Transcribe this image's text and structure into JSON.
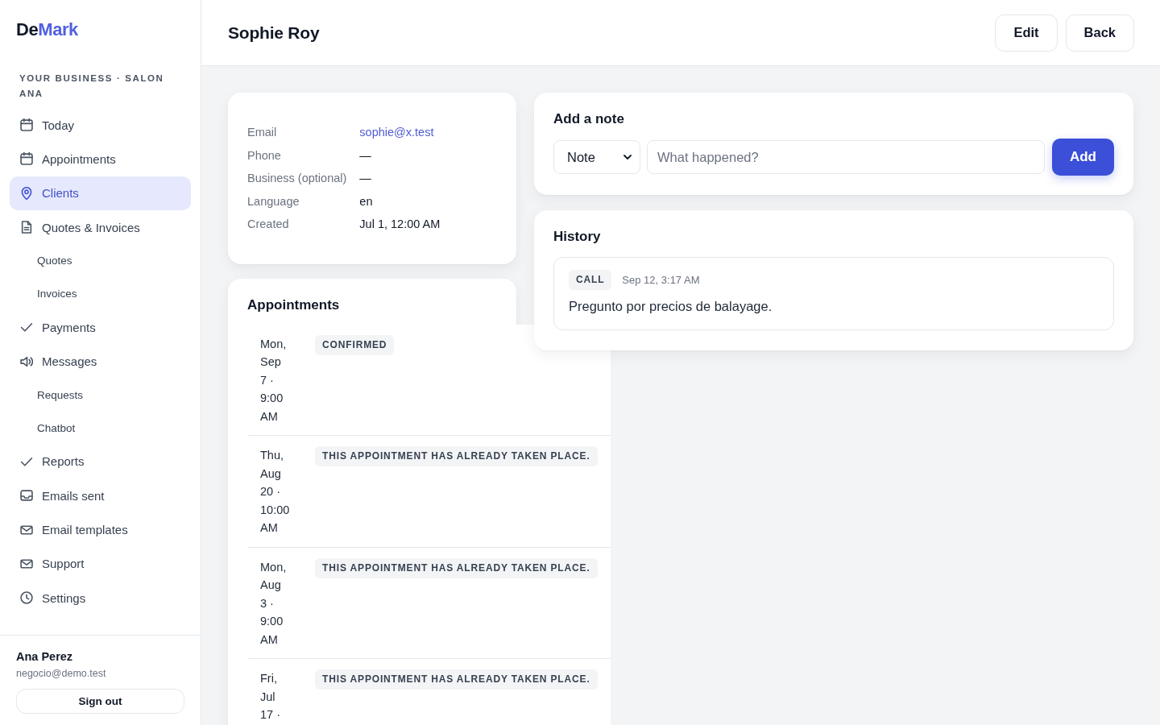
{
  "sidebar": {
    "logo": [
      {
        "text": "De",
        "accent": false
      },
      {
        "text": "Mark",
        "accent": true
      }
    ],
    "business": "YOUR BUSINESS · SALON ANA",
    "nav": [
      {
        "label": "Today",
        "selected": false
      },
      {
        "label": "Appointments",
        "selected": false
      },
      {
        "label": "Clients",
        "selected": true
      },
      {
        "label": "Quotes & Invoices",
        "selected": false,
        "children": [
          {
            "label": "Quotes",
            "selected": false
          },
          {
            "label": "Invoices",
            "selected": false
          }
        ]
      },
      {
        "label": "Payments",
        "selected": false
      },
      {
        "label": "Messages",
        "selected": false,
        "children": [
          {
            "label": "Requests",
            "selected": false
          },
          {
            "label": "Chatbot",
            "selected": false
          }
        ]
      },
      {
        "label": "Reports",
        "selected": false
      },
      {
        "label": "Emails sent",
        "selected": false
      },
      {
        "label": "Email templates",
        "selected": false
      },
      {
        "label": "Support",
        "selected": false
      },
      {
        "label": "Settings",
        "selected": false
      }
    ],
    "user": {
      "name": "Ana Perez",
      "email": "negocio@demo.test"
    },
    "sign_out": "Sign out"
  },
  "header": {
    "title": "Sophie Roy",
    "buttons": [
      "Edit",
      "Back"
    ]
  },
  "client": {
    "fields": [
      {
        "label": "Email",
        "value": "sophie@x.test",
        "kind": "link"
      },
      {
        "label": "Phone",
        "value": "—",
        "kind": "text"
      },
      {
        "label": "Business (optional)",
        "value": "—",
        "kind": "text"
      },
      {
        "label": "Language",
        "value": "en",
        "kind": "text"
      },
      {
        "label": "Created",
        "value": "Jul 1, 12:00 AM",
        "kind": "text"
      }
    ]
  },
  "appointments": {
    "title": "Appointments",
    "rows": [
      {
        "date": "Mon, Sep 7 · 9:00 AM",
        "status": "CONFIRMED"
      },
      {
        "date": "Thu, Aug 20 · 10:00 AM",
        "status": "THIS APPOINTMENT HAS ALREADY TAKEN PLACE."
      },
      {
        "date": "Mon, Aug 3 · 9:00 AM",
        "status": "THIS APPOINTMENT HAS ALREADY TAKEN PLACE."
      },
      {
        "date": "Fri, Jul 17 ·",
        "status": "THIS APPOINTMENT HAS ALREADY TAKEN PLACE."
      }
    ]
  },
  "note_form": {
    "title": "Add a note",
    "type": "Note",
    "placeholder": "What happened?",
    "button": "Add"
  },
  "history": {
    "title": "History",
    "entries": [
      {
        "type": "CALL",
        "time": "Sep 12, 3:17 AM",
        "text": "Pregunto por precios de balayage."
      }
    ]
  }
}
